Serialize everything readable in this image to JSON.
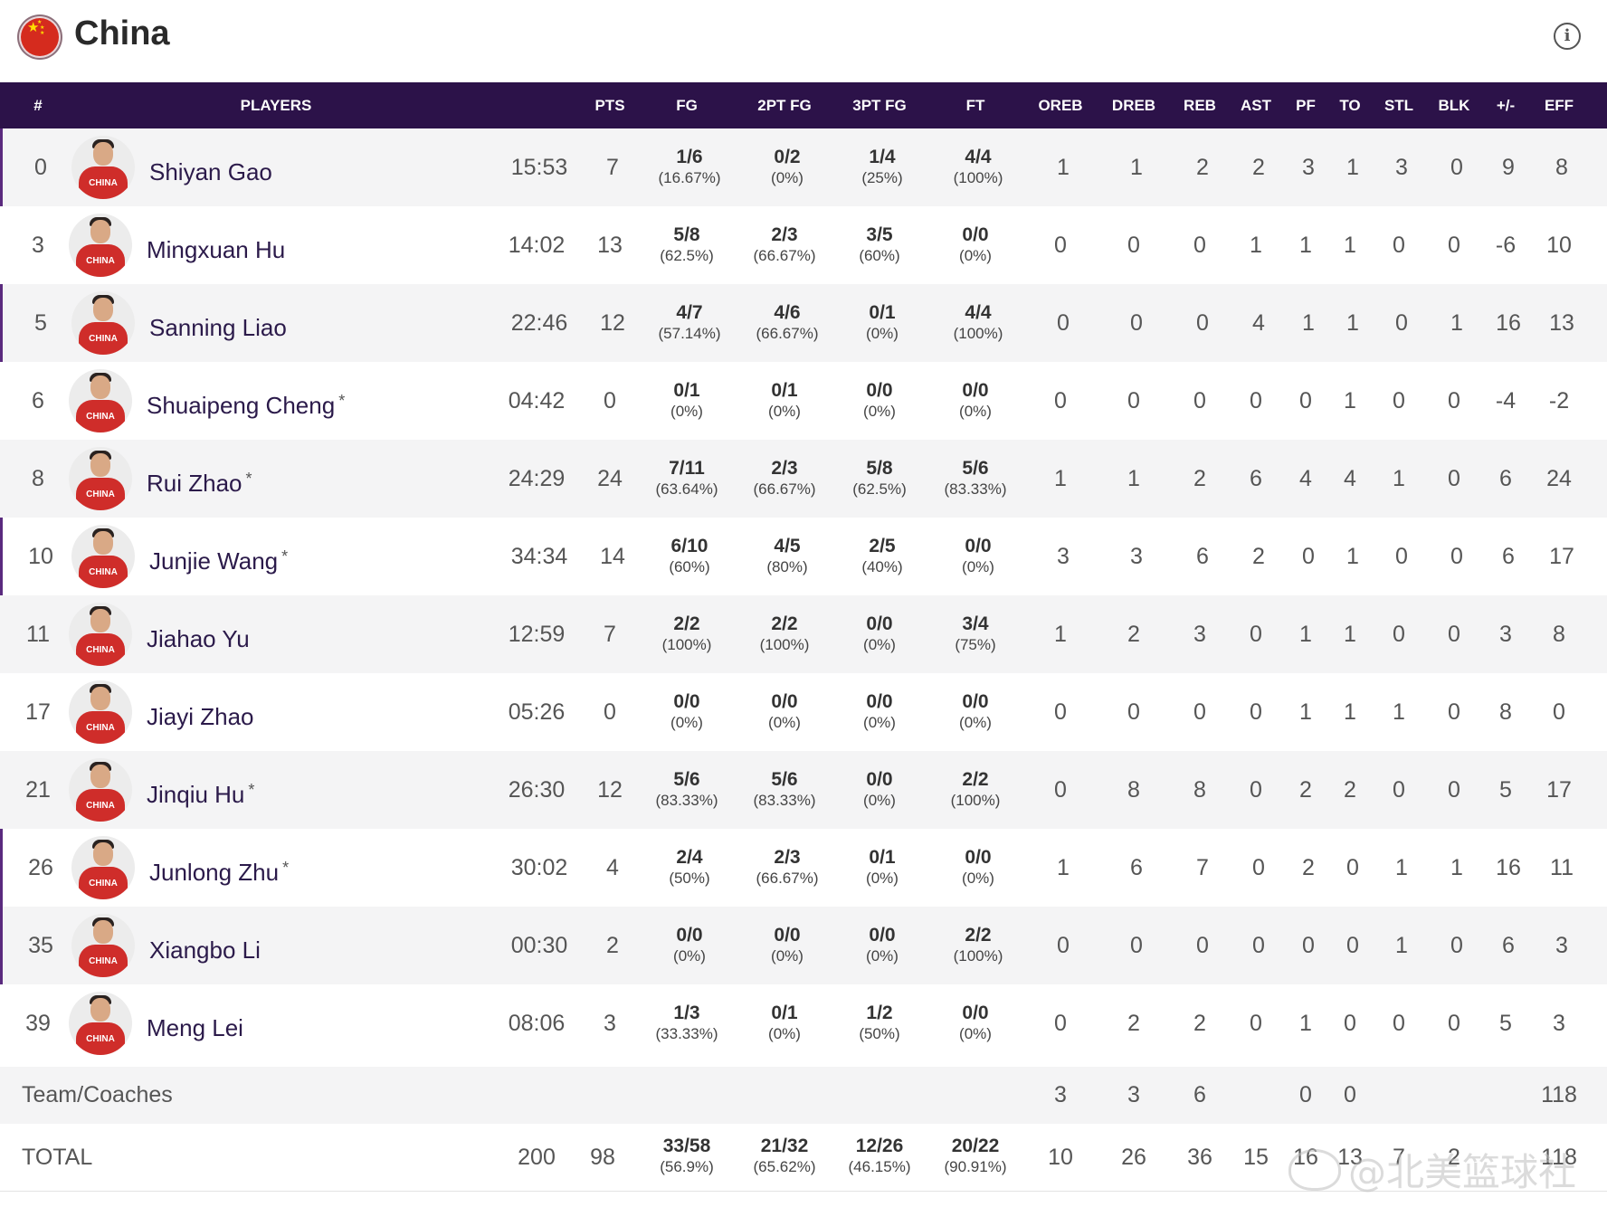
{
  "team": {
    "name": "China"
  },
  "columns": {
    "number": "#",
    "players": "PLAYERS",
    "pts": "PTS",
    "fg": "FG",
    "fg2": "2PT FG",
    "fg3": "3PT FG",
    "ft": "FT",
    "oreb": "OREB",
    "dreb": "DREB",
    "reb": "REB",
    "ast": "AST",
    "pf": "PF",
    "to": "TO",
    "stl": "STL",
    "blk": "BLK",
    "plus_minus": "+/-",
    "eff": "EFF"
  },
  "players": [
    {
      "number": "0",
      "name": "Shiyan Gao",
      "starter": "",
      "min": "15:53",
      "pts": "7",
      "fg": "1/6",
      "fg_pct": "(16.67%)",
      "fg2": "0/2",
      "fg2_pct": "(0%)",
      "fg3": "1/4",
      "fg3_pct": "(25%)",
      "ft": "4/4",
      "ft_pct": "(100%)",
      "oreb": "1",
      "dreb": "1",
      "reb": "2",
      "ast": "2",
      "pf": "3",
      "to": "1",
      "stl": "3",
      "blk": "0",
      "pm": "9",
      "eff": "8",
      "jersey": "CHINA"
    },
    {
      "number": "3",
      "name": "Mingxuan Hu",
      "starter": "",
      "min": "14:02",
      "pts": "13",
      "fg": "5/8",
      "fg_pct": "(62.5%)",
      "fg2": "2/3",
      "fg2_pct": "(66.67%)",
      "fg3": "3/5",
      "fg3_pct": "(60%)",
      "ft": "0/0",
      "ft_pct": "(0%)",
      "oreb": "0",
      "dreb": "0",
      "reb": "0",
      "ast": "1",
      "pf": "1",
      "to": "1",
      "stl": "0",
      "blk": "0",
      "pm": "-6",
      "eff": "10",
      "jersey": "CHINA"
    },
    {
      "number": "5",
      "name": "Sanning Liao",
      "starter": "",
      "min": "22:46",
      "pts": "12",
      "fg": "4/7",
      "fg_pct": "(57.14%)",
      "fg2": "4/6",
      "fg2_pct": "(66.67%)",
      "fg3": "0/1",
      "fg3_pct": "(0%)",
      "ft": "4/4",
      "ft_pct": "(100%)",
      "oreb": "0",
      "dreb": "0",
      "reb": "0",
      "ast": "4",
      "pf": "1",
      "to": "1",
      "stl": "0",
      "blk": "1",
      "pm": "16",
      "eff": "13",
      "jersey": "CHINA"
    },
    {
      "number": "6",
      "name": "Shuaipeng Cheng",
      "starter": "*",
      "min": "04:42",
      "pts": "0",
      "fg": "0/1",
      "fg_pct": "(0%)",
      "fg2": "0/1",
      "fg2_pct": "(0%)",
      "fg3": "0/0",
      "fg3_pct": "(0%)",
      "ft": "0/0",
      "ft_pct": "(0%)",
      "oreb": "0",
      "dreb": "0",
      "reb": "0",
      "ast": "0",
      "pf": "0",
      "to": "1",
      "stl": "0",
      "blk": "0",
      "pm": "-4",
      "eff": "-2",
      "jersey": "CHINA"
    },
    {
      "number": "8",
      "name": "Rui Zhao",
      "starter": "*",
      "min": "24:29",
      "pts": "24",
      "fg": "7/11",
      "fg_pct": "(63.64%)",
      "fg2": "2/3",
      "fg2_pct": "(66.67%)",
      "fg3": "5/8",
      "fg3_pct": "(62.5%)",
      "ft": "5/6",
      "ft_pct": "(83.33%)",
      "oreb": "1",
      "dreb": "1",
      "reb": "2",
      "ast": "6",
      "pf": "4",
      "to": "4",
      "stl": "1",
      "blk": "0",
      "pm": "6",
      "eff": "24",
      "jersey": "CHINA"
    },
    {
      "number": "10",
      "name": "Junjie Wang",
      "starter": "*",
      "min": "34:34",
      "pts": "14",
      "fg": "6/10",
      "fg_pct": "(60%)",
      "fg2": "4/5",
      "fg2_pct": "(80%)",
      "fg3": "2/5",
      "fg3_pct": "(40%)",
      "ft": "0/0",
      "ft_pct": "(0%)",
      "oreb": "3",
      "dreb": "3",
      "reb": "6",
      "ast": "2",
      "pf": "0",
      "to": "1",
      "stl": "0",
      "blk": "0",
      "pm": "6",
      "eff": "17",
      "jersey": "CHINA"
    },
    {
      "number": "11",
      "name": "Jiahao Yu",
      "starter": "",
      "min": "12:59",
      "pts": "7",
      "fg": "2/2",
      "fg_pct": "(100%)",
      "fg2": "2/2",
      "fg2_pct": "(100%)",
      "fg3": "0/0",
      "fg3_pct": "(0%)",
      "ft": "3/4",
      "ft_pct": "(75%)",
      "oreb": "1",
      "dreb": "2",
      "reb": "3",
      "ast": "0",
      "pf": "1",
      "to": "1",
      "stl": "0",
      "blk": "0",
      "pm": "3",
      "eff": "8",
      "jersey": "CHINA"
    },
    {
      "number": "17",
      "name": "Jiayi Zhao",
      "starter": "",
      "min": "05:26",
      "pts": "0",
      "fg": "0/0",
      "fg_pct": "(0%)",
      "fg2": "0/0",
      "fg2_pct": "(0%)",
      "fg3": "0/0",
      "fg3_pct": "(0%)",
      "ft": "0/0",
      "ft_pct": "(0%)",
      "oreb": "0",
      "dreb": "0",
      "reb": "0",
      "ast": "0",
      "pf": "1",
      "to": "1",
      "stl": "1",
      "blk": "0",
      "pm": "8",
      "eff": "0",
      "jersey": "CHINA"
    },
    {
      "number": "21",
      "name": "Jinqiu Hu",
      "starter": "*",
      "min": "26:30",
      "pts": "12",
      "fg": "5/6",
      "fg_pct": "(83.33%)",
      "fg2": "5/6",
      "fg2_pct": "(83.33%)",
      "fg3": "0/0",
      "fg3_pct": "(0%)",
      "ft": "2/2",
      "ft_pct": "(100%)",
      "oreb": "0",
      "dreb": "8",
      "reb": "8",
      "ast": "0",
      "pf": "2",
      "to": "2",
      "stl": "0",
      "blk": "0",
      "pm": "5",
      "eff": "17",
      "jersey": "CHINA"
    },
    {
      "number": "26",
      "name": "Junlong Zhu",
      "starter": "*",
      "min": "30:02",
      "pts": "4",
      "fg": "2/4",
      "fg_pct": "(50%)",
      "fg2": "2/3",
      "fg2_pct": "(66.67%)",
      "fg3": "0/1",
      "fg3_pct": "(0%)",
      "ft": "0/0",
      "ft_pct": "(0%)",
      "oreb": "1",
      "dreb": "6",
      "reb": "7",
      "ast": "0",
      "pf": "2",
      "to": "0",
      "stl": "1",
      "blk": "1",
      "pm": "16",
      "eff": "11",
      "jersey": "CHINA"
    },
    {
      "number": "35",
      "name": "Xiangbo Li",
      "starter": "",
      "min": "00:30",
      "pts": "2",
      "fg": "0/0",
      "fg_pct": "(0%)",
      "fg2": "0/0",
      "fg2_pct": "(0%)",
      "fg3": "0/0",
      "fg3_pct": "(0%)",
      "ft": "2/2",
      "ft_pct": "(100%)",
      "oreb": "0",
      "dreb": "0",
      "reb": "0",
      "ast": "0",
      "pf": "0",
      "to": "0",
      "stl": "1",
      "blk": "0",
      "pm": "6",
      "eff": "3",
      "jersey": "CHINA"
    },
    {
      "number": "39",
      "name": "Meng Lei",
      "starter": "",
      "min": "08:06",
      "pts": "3",
      "fg": "1/3",
      "fg_pct": "(33.33%)",
      "fg2": "0/1",
      "fg2_pct": "(0%)",
      "fg3": "1/2",
      "fg3_pct": "(50%)",
      "ft": "0/0",
      "ft_pct": "(0%)",
      "oreb": "0",
      "dreb": "2",
      "reb": "2",
      "ast": "0",
      "pf": "1",
      "to": "0",
      "stl": "0",
      "blk": "0",
      "pm": "5",
      "eff": "3",
      "jersey": "CHINA"
    }
  ],
  "team_coaches": {
    "label": "Team/Coaches",
    "oreb": "3",
    "dreb": "3",
    "reb": "6",
    "pf": "0",
    "to": "0",
    "eff": "118"
  },
  "total": {
    "label": "TOTAL",
    "min": "200",
    "pts": "98",
    "fg": "33/58",
    "fg_pct": "(56.9%)",
    "fg2": "21/32",
    "fg2_pct": "(65.62%)",
    "fg3": "12/26",
    "fg3_pct": "(46.15%)",
    "ft": "20/22",
    "ft_pct": "(90.91%)",
    "oreb": "10",
    "dreb": "26",
    "reb": "36",
    "ast": "15",
    "pf": "16",
    "to": "13",
    "stl": "7",
    "blk": "2",
    "eff": "118"
  },
  "watermark": "@北美篮球社",
  "colors": {
    "header_bg": "#2c1249",
    "alt_row_bg": "#f4f4f5",
    "name_color": "#2b1a4a",
    "row_accent": "#5a2a7e"
  }
}
